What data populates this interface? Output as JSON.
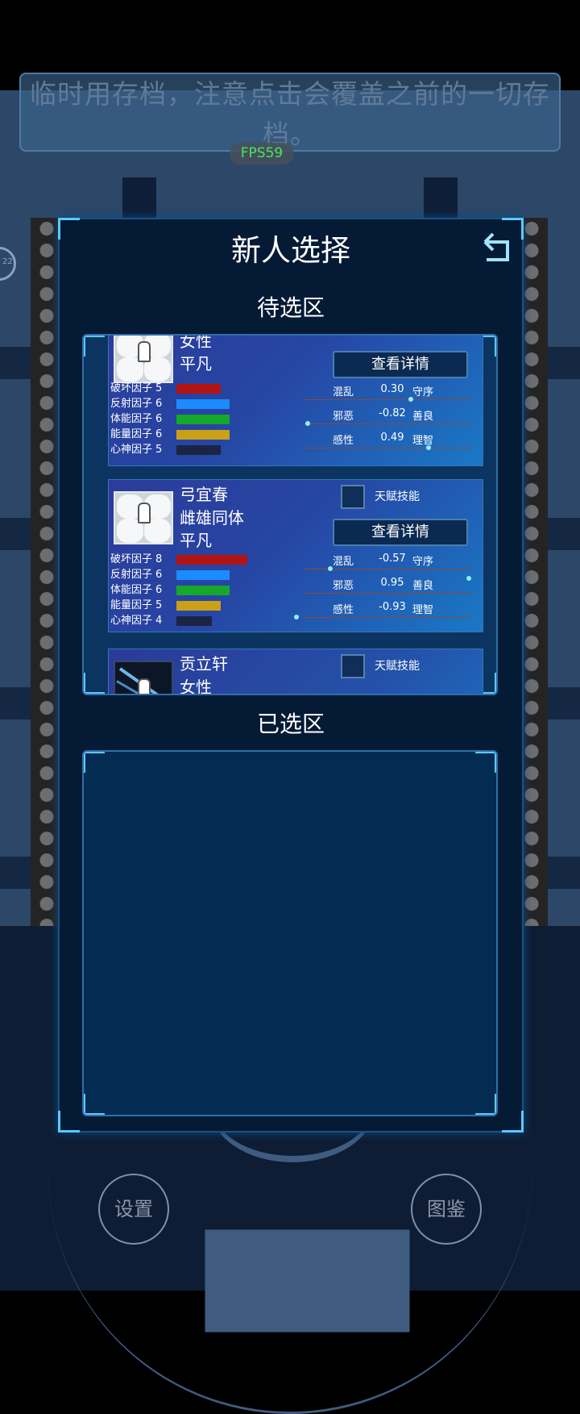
{
  "notice": {
    "text": "临时用存档，注意点击会覆盖之前的一切存档。"
  },
  "fps": "FPS59",
  "left_badge": "22",
  "bottom_buttons": {
    "settings": "设置",
    "gallery": "图鉴"
  },
  "modal": {
    "title": "新人选择",
    "pending_title": "待选区",
    "selected_title": "已选区"
  },
  "detail_label": "查看详情",
  "talent_label": "天赋技能",
  "factor_names": [
    "破坏因子",
    "反射因子",
    "体能因子",
    "能量因子",
    "心神因子"
  ],
  "factor_colors": [
    "#b21414",
    "#1a8cff",
    "#16a82a",
    "#c9a016",
    "#1c2444"
  ],
  "attr_left": [
    "混乱",
    "邪恶",
    "感性"
  ],
  "attr_right": [
    "守序",
    "善良",
    "理智"
  ],
  "candidates": [
    {
      "lines": [
        "女性",
        "平凡"
      ],
      "factors": [
        5,
        6,
        6,
        6,
        5
      ],
      "attrs": [
        "0.30",
        "-0.82",
        "0.49"
      ]
    },
    {
      "lines": [
        "弓宜春",
        "雌雄同体",
        "平凡"
      ],
      "factors": [
        8,
        6,
        6,
        5,
        4
      ],
      "attrs": [
        "-0.57",
        "0.95",
        "-0.93"
      ]
    },
    {
      "lines": [
        "贡立轩",
        "女性"
      ]
    }
  ]
}
